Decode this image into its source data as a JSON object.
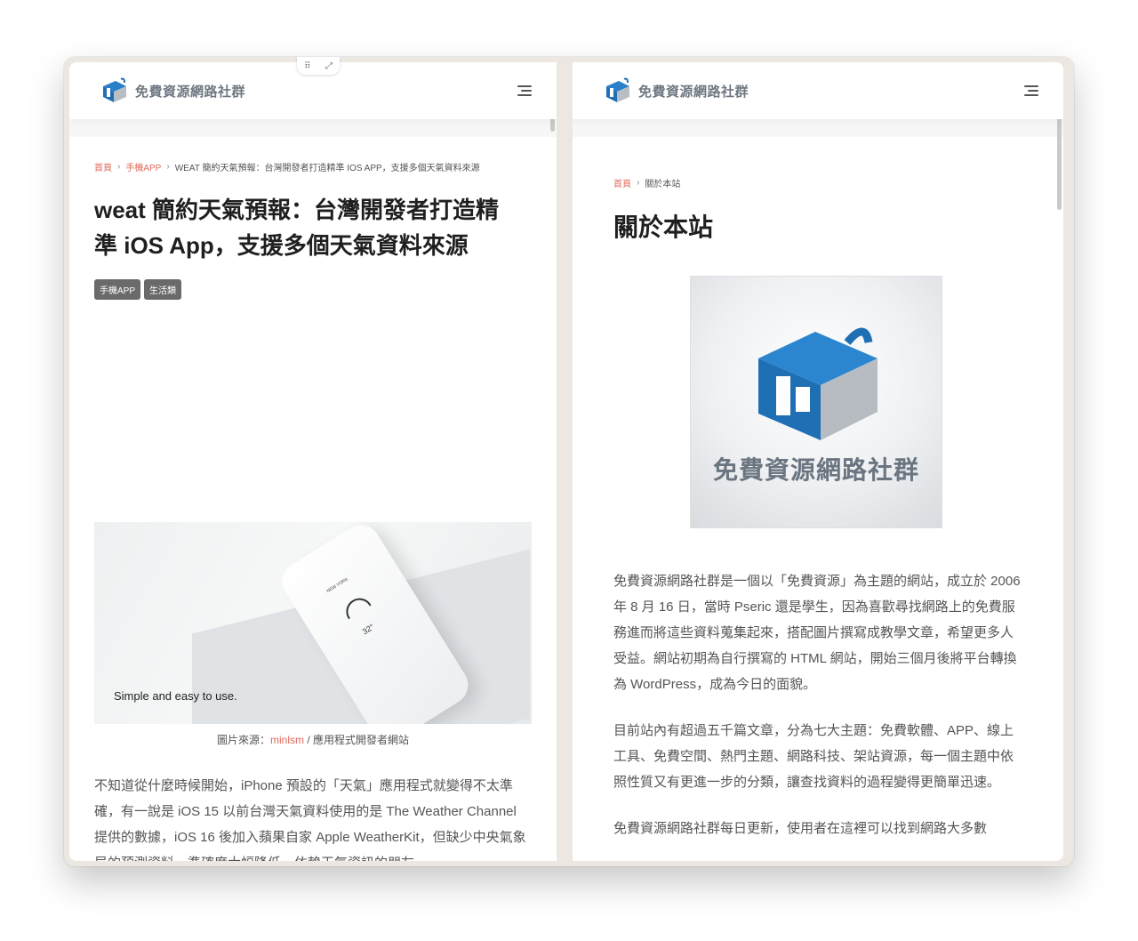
{
  "site": {
    "name": "免費資源網路社群"
  },
  "left": {
    "breadcrumb": {
      "home": "首頁",
      "category": "手機APP",
      "current": "WEAT 簡約天氣預報：台灣開發者打造精準 IOS APP，支援多個天氣資料來源"
    },
    "title": "weat 簡約天氣預報：台灣開發者打造精準 iOS App，支援多個天氣資料來源",
    "tags": [
      "手機APP",
      "生活類"
    ],
    "hero": {
      "caption": "Simple and easy to use.",
      "phone_city": "NEW YORK",
      "phone_temp": "32°"
    },
    "image_credit": {
      "prefix": "圖片來源：",
      "link": "minlsm",
      "suffix": " / 應用程式開發者網站"
    },
    "body": "不知道從什麼時候開始，iPhone 預設的「天氣」應用程式就變得不太準確，有一說是 iOS 15 以前台灣天氣資料使用的是 The Weather Channel 提供的數據，iOS 16 後加入蘋果自家 Apple WeatherKit，但缺少中央氣象局的預測資料，準確度大幅降低，依賴天氣資訊的朋友"
  },
  "right": {
    "breadcrumb": {
      "home": "首頁",
      "current": "關於本站"
    },
    "title": "關於本站",
    "logo_text": "免費資源網路社群",
    "paragraphs": [
      "免費資源網路社群是一個以「免費資源」為主題的網站，成立於 2006 年 8 月 16 日，當時 Pseric 還是學生，因為喜歡尋找網路上的免費服務進而將這些資料蒐集起來，搭配圖片撰寫成教學文章，希望更多人受益。網站初期為自行撰寫的 HTML 網站，開始三個月後將平台轉換為 WordPress，成為今日的面貌。",
      "目前站內有超過五千篇文章，分為七大主題：免費軟體、APP、線上工具、免費空間、熱門主題、網路科技、架站資源，每一個主題中依照性質又有更進一步的分類，讓查找資料的過程變得更簡單迅速。",
      "免費資源網路社群每日更新，使用者在這裡可以找到網路大多數"
    ]
  },
  "colors": {
    "accent": "#e0685a",
    "logo_blue": "#1f6fb5",
    "tag_bg": "#6a6a6a"
  },
  "icons": [
    "site-logo-icon",
    "hamburger-menu-icon",
    "drag-handle-icon",
    "expand-icon"
  ]
}
